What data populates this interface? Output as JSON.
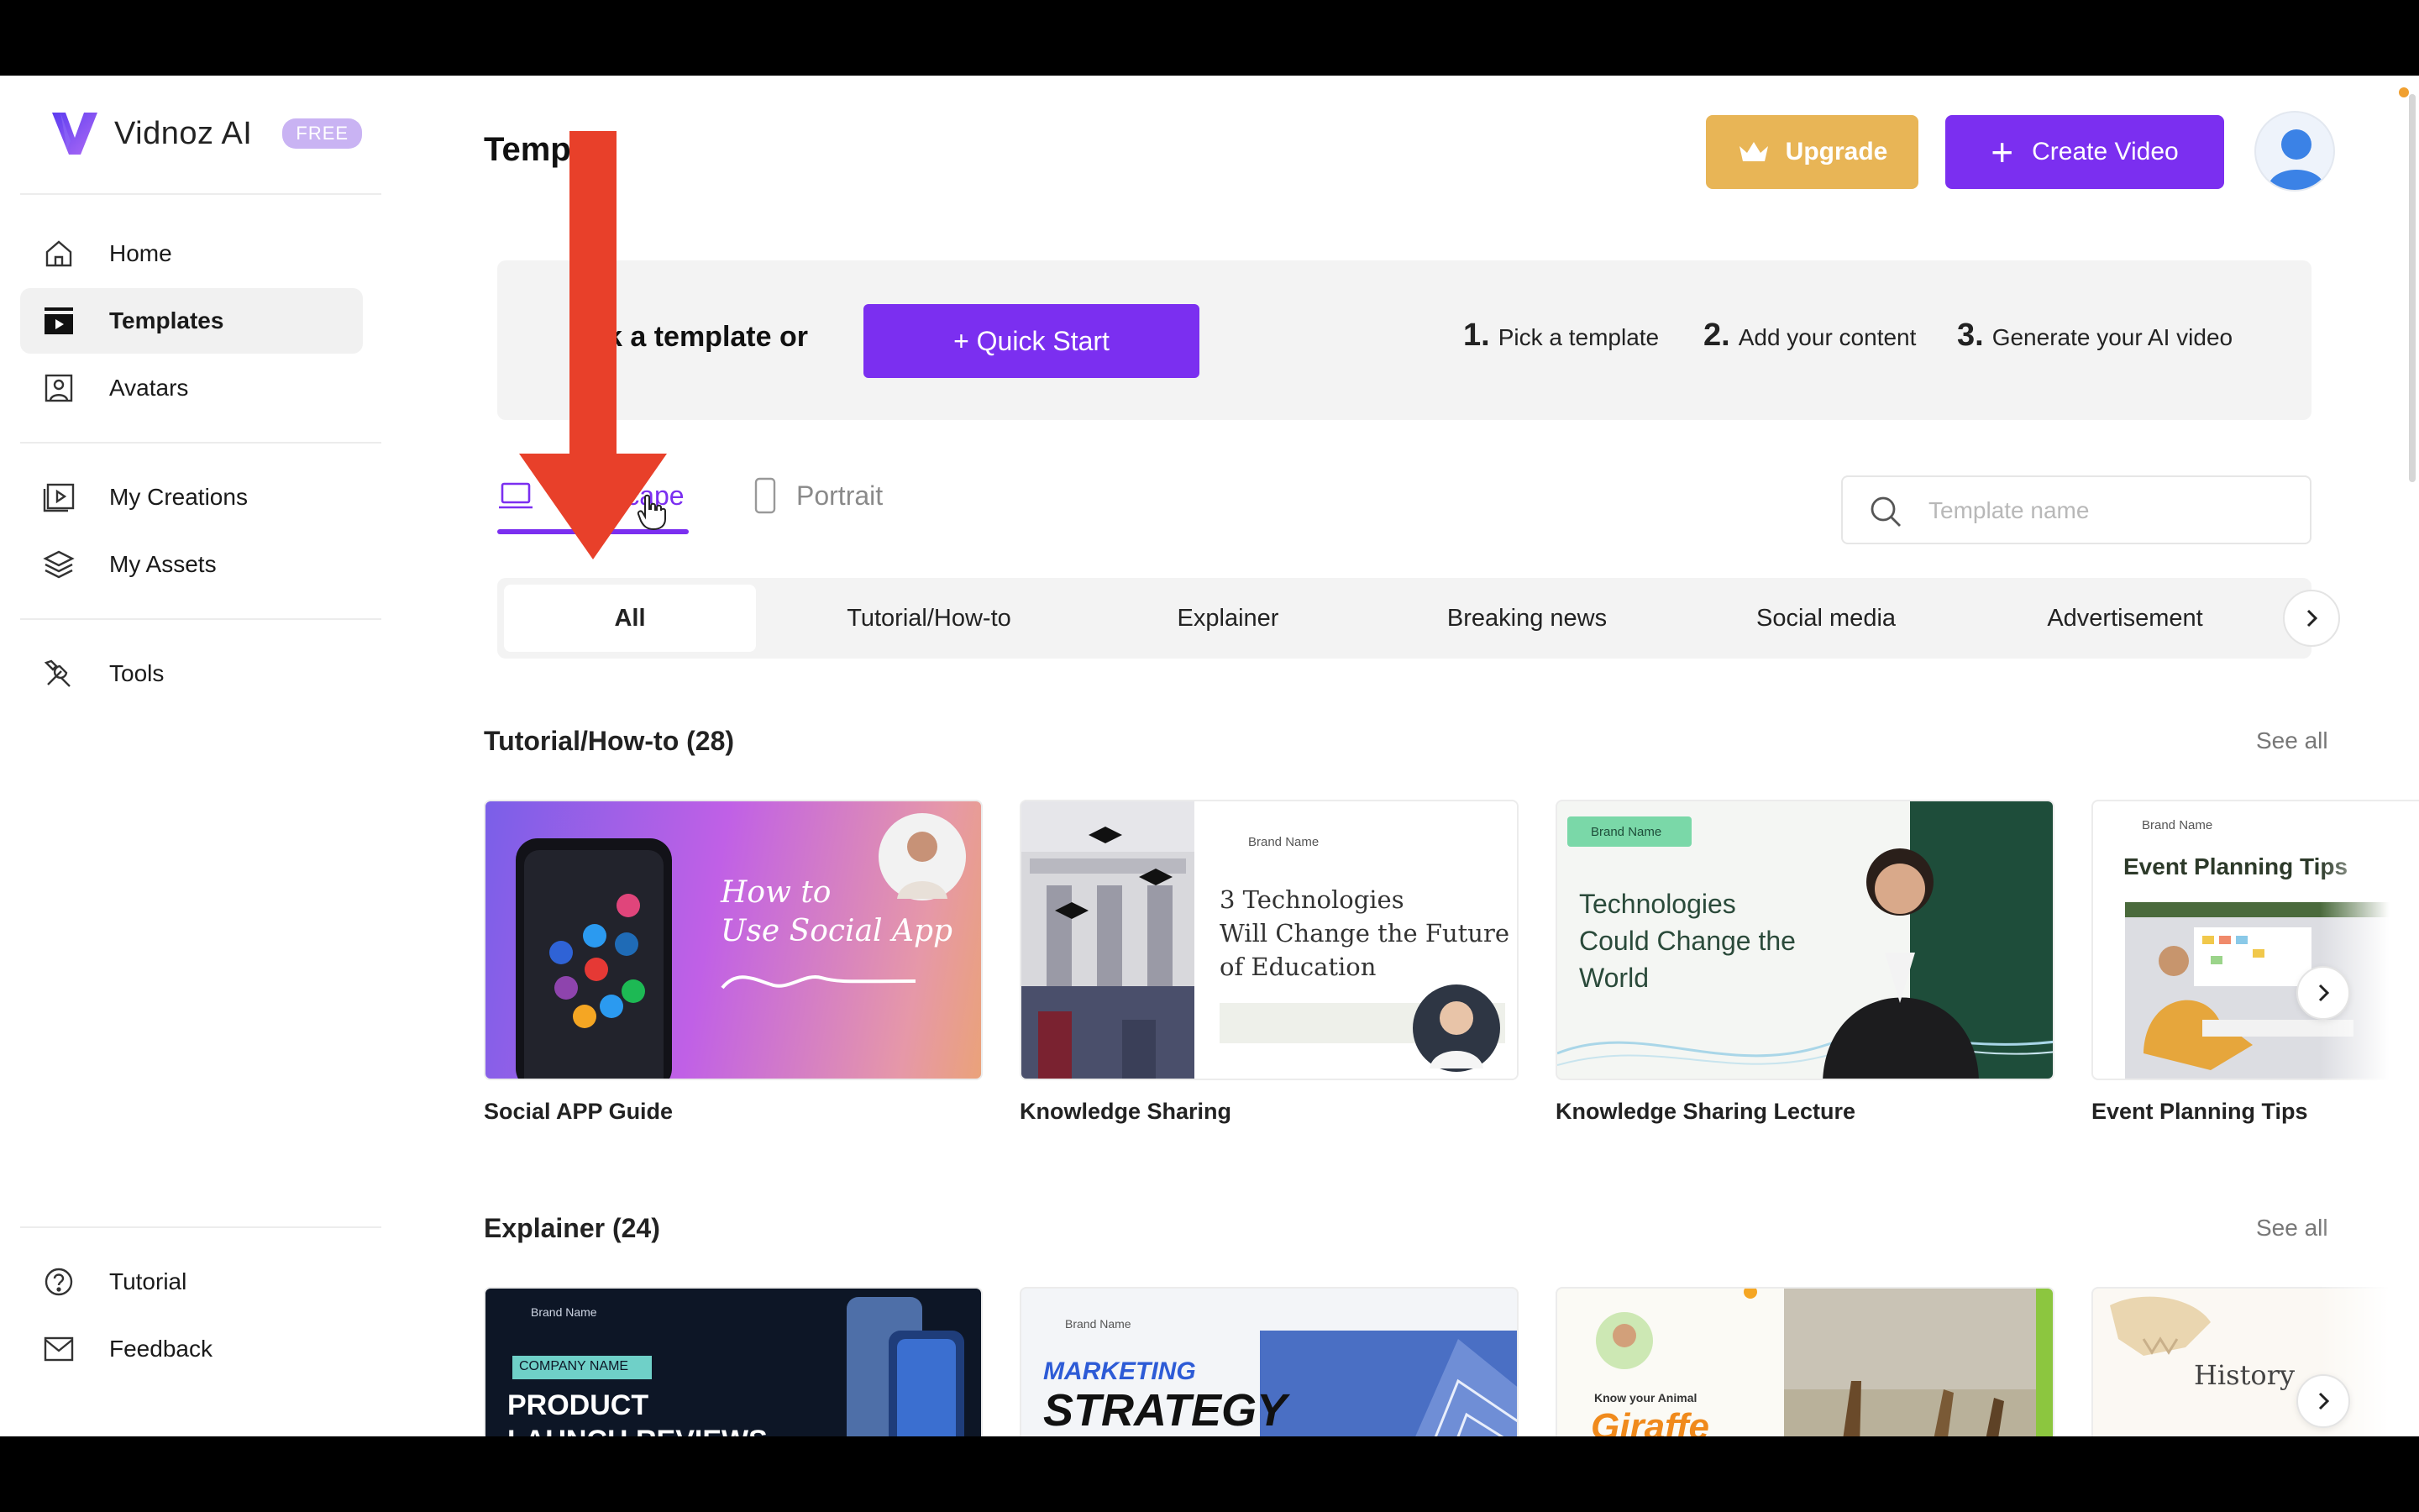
{
  "app": {
    "name": "Vidnoz AI",
    "plan_badge": "FREE"
  },
  "sidebar": {
    "items": [
      {
        "label": "Home",
        "icon": "home-icon"
      },
      {
        "label": "Templates",
        "icon": "templates-icon",
        "active": true
      },
      {
        "label": "Avatars",
        "icon": "avatar-icon"
      },
      {
        "label": "My Creations",
        "icon": "play-icon"
      },
      {
        "label": "My Assets",
        "icon": "layers-icon"
      },
      {
        "label": "Tools",
        "icon": "tools-icon"
      }
    ],
    "footer": [
      {
        "label": "Tutorial",
        "icon": "help-icon"
      },
      {
        "label": "Feedback",
        "icon": "mail-icon"
      }
    ]
  },
  "header": {
    "title": "Templates",
    "title_visible": "Temp   s",
    "upgrade_label": "Upgrade",
    "create_label": "Create Video"
  },
  "banner": {
    "text_visible": "k a template or",
    "quick_start_label": "+ Quick Start",
    "steps": [
      {
        "num": "1.",
        "label": "Pick a template"
      },
      {
        "num": "2.",
        "label": "Add your content"
      },
      {
        "num": "3.",
        "label": "Generate your AI video"
      }
    ]
  },
  "orientation": {
    "tabs": [
      {
        "label": "Landscape",
        "active": true
      },
      {
        "label": "Portrait"
      }
    ]
  },
  "search": {
    "placeholder": "Template name",
    "value": ""
  },
  "categories": [
    "All",
    "Tutorial/How-to",
    "Explainer",
    "Breaking news",
    "Social media",
    "Advertisement"
  ],
  "sections": [
    {
      "title": "Tutorial/How-to (28)",
      "see_all": "See all",
      "cards": [
        {
          "title": "Social APP Guide",
          "thumb_text": [
            "How to",
            "Use Social App"
          ]
        },
        {
          "title": "Knowledge Sharing",
          "thumb_brand": "Brand Name",
          "thumb_text": [
            "3 Technologies",
            "Will Change the Future",
            "of Education"
          ]
        },
        {
          "title": "Knowledge Sharing Lecture",
          "thumb_brand": "Brand Name",
          "thumb_text": [
            "Technologies",
            "Could Change the",
            "World"
          ]
        },
        {
          "title": "Event Planning Tips",
          "thumb_brand": "Brand Name",
          "thumb_text": [
            "Event Planning Tips"
          ]
        }
      ]
    },
    {
      "title": "Explainer (24)",
      "see_all": "See all",
      "cards": [
        {
          "thumb_brand": "Brand Name",
          "thumb_text": [
            "COMPANY NAME",
            "PRODUCT",
            "LAUNCH REVIEWS"
          ]
        },
        {
          "thumb_brand": "Brand Name",
          "thumb_text": [
            "MARKETING",
            "STRATEGY"
          ]
        },
        {
          "thumb_text": [
            "Know your Animal",
            "Giraffe"
          ]
        },
        {
          "thumb_text": [
            "History"
          ]
        }
      ]
    }
  ],
  "colors": {
    "accent": "#7b2ff0",
    "upgrade": "#e8b556",
    "annotation_arrow": "#e8402a"
  }
}
